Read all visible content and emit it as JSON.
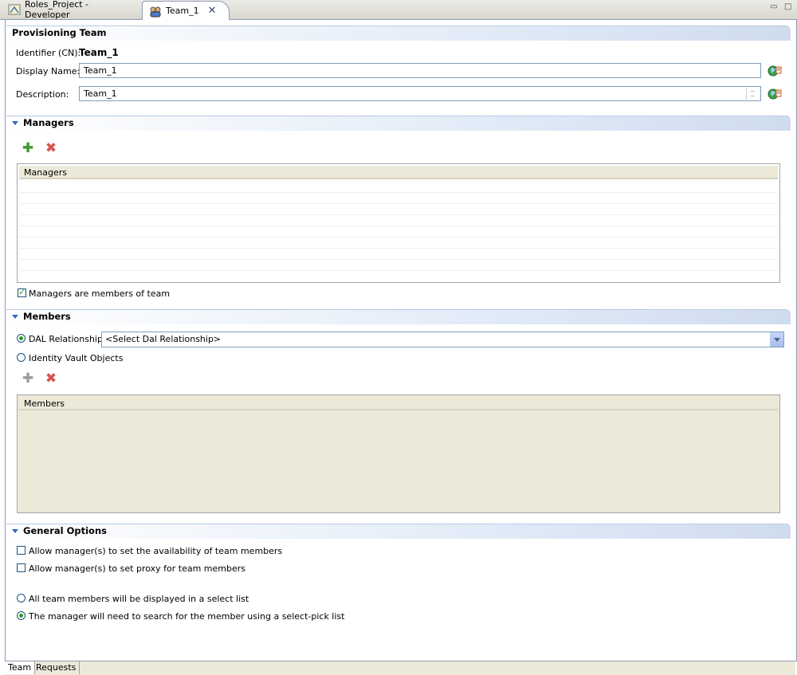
{
  "tabs": [
    {
      "label": "Roles_Project - Developer",
      "icon": "project-icon"
    },
    {
      "label": "Team_1",
      "icon": "team-icon",
      "closable": true
    }
  ],
  "provisioning": {
    "header": "Provisioning Team",
    "identifier_label": "Identifier (CN):",
    "identifier_value": "Team_1",
    "display_name_label": "Display Name:",
    "display_name_value": "Team_1",
    "description_label": "Description:",
    "description_value": "Team_1"
  },
  "managers": {
    "header": "Managers",
    "column": "Managers",
    "checkbox_label": "Managers are members of team",
    "checkbox_checked": true
  },
  "members": {
    "header": "Members",
    "radio_dal_label": "DAL Relationship",
    "dal_select_value": "<Select Dal Relationship>",
    "radio_vault_label": "Identity Vault Objects",
    "column": "Members"
  },
  "general": {
    "header": "General Options",
    "opt1_label": "Allow manager(s) to set the availability of team members",
    "opt2_label": "Allow manager(s) to set proxy for team members",
    "radio1_label": "All team members will be displayed in a select list",
    "radio2_label": "The manager will need to search for the member using a select-pick list"
  },
  "bottom_tabs": [
    "Team",
    "Requests"
  ]
}
